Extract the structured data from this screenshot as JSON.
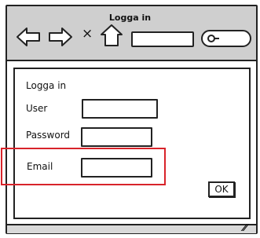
{
  "window": {
    "title": "Logga in"
  },
  "toolbar": {
    "icons": [
      "back-arrow-icon",
      "forward-arrow-icon",
      "close-icon",
      "home-icon",
      "search-icon"
    ],
    "close_glyph": "×",
    "url_value": "",
    "search_value": ""
  },
  "form": {
    "title": "Logga in",
    "user_label": "User",
    "password_label": "Password",
    "email_label": "Email",
    "user_value": "",
    "password_value": "",
    "email_value": "",
    "ok_label": "OK"
  },
  "statusbar": {
    "grip_glyph": "⁄⁄"
  },
  "colors": {
    "highlight": "#d8232a",
    "toolbar_bg": "#cfcfcf",
    "border": "#222222"
  }
}
